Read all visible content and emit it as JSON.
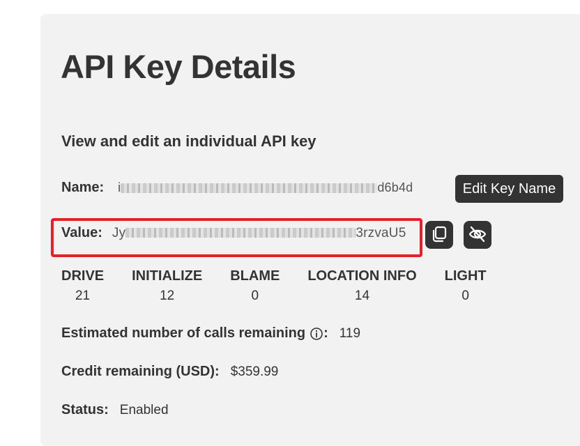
{
  "page": {
    "title": "API Key Details",
    "subtitle": "View and edit an individual API key"
  },
  "name_row": {
    "label": "Name:",
    "value_prefix": "i",
    "value_suffix": "d6b4d",
    "edit_button": "Edit Key Name"
  },
  "value_row": {
    "label": "Value:",
    "value_prefix": "Jy",
    "value_suffix": "3rzvaU5",
    "copy_icon": "copy-icon",
    "hide_icon": "eye-off-icon",
    "highlight_color": "#e5202a"
  },
  "stats": [
    {
      "name": "DRIVE",
      "value": "21"
    },
    {
      "name": "INITIALIZE",
      "value": "12"
    },
    {
      "name": "BLAME",
      "value": "0"
    },
    {
      "name": "LOCATION INFO",
      "value": "14"
    },
    {
      "name": "LIGHT",
      "value": "0"
    }
  ],
  "calls": {
    "label": "Estimated number of calls remaining",
    "info_icon": "info-icon",
    "separator": ":",
    "value": "119"
  },
  "credit": {
    "label": "Credit remaining (USD):",
    "value": "$359.99"
  },
  "status": {
    "label": "Status:",
    "value": "Enabled"
  }
}
